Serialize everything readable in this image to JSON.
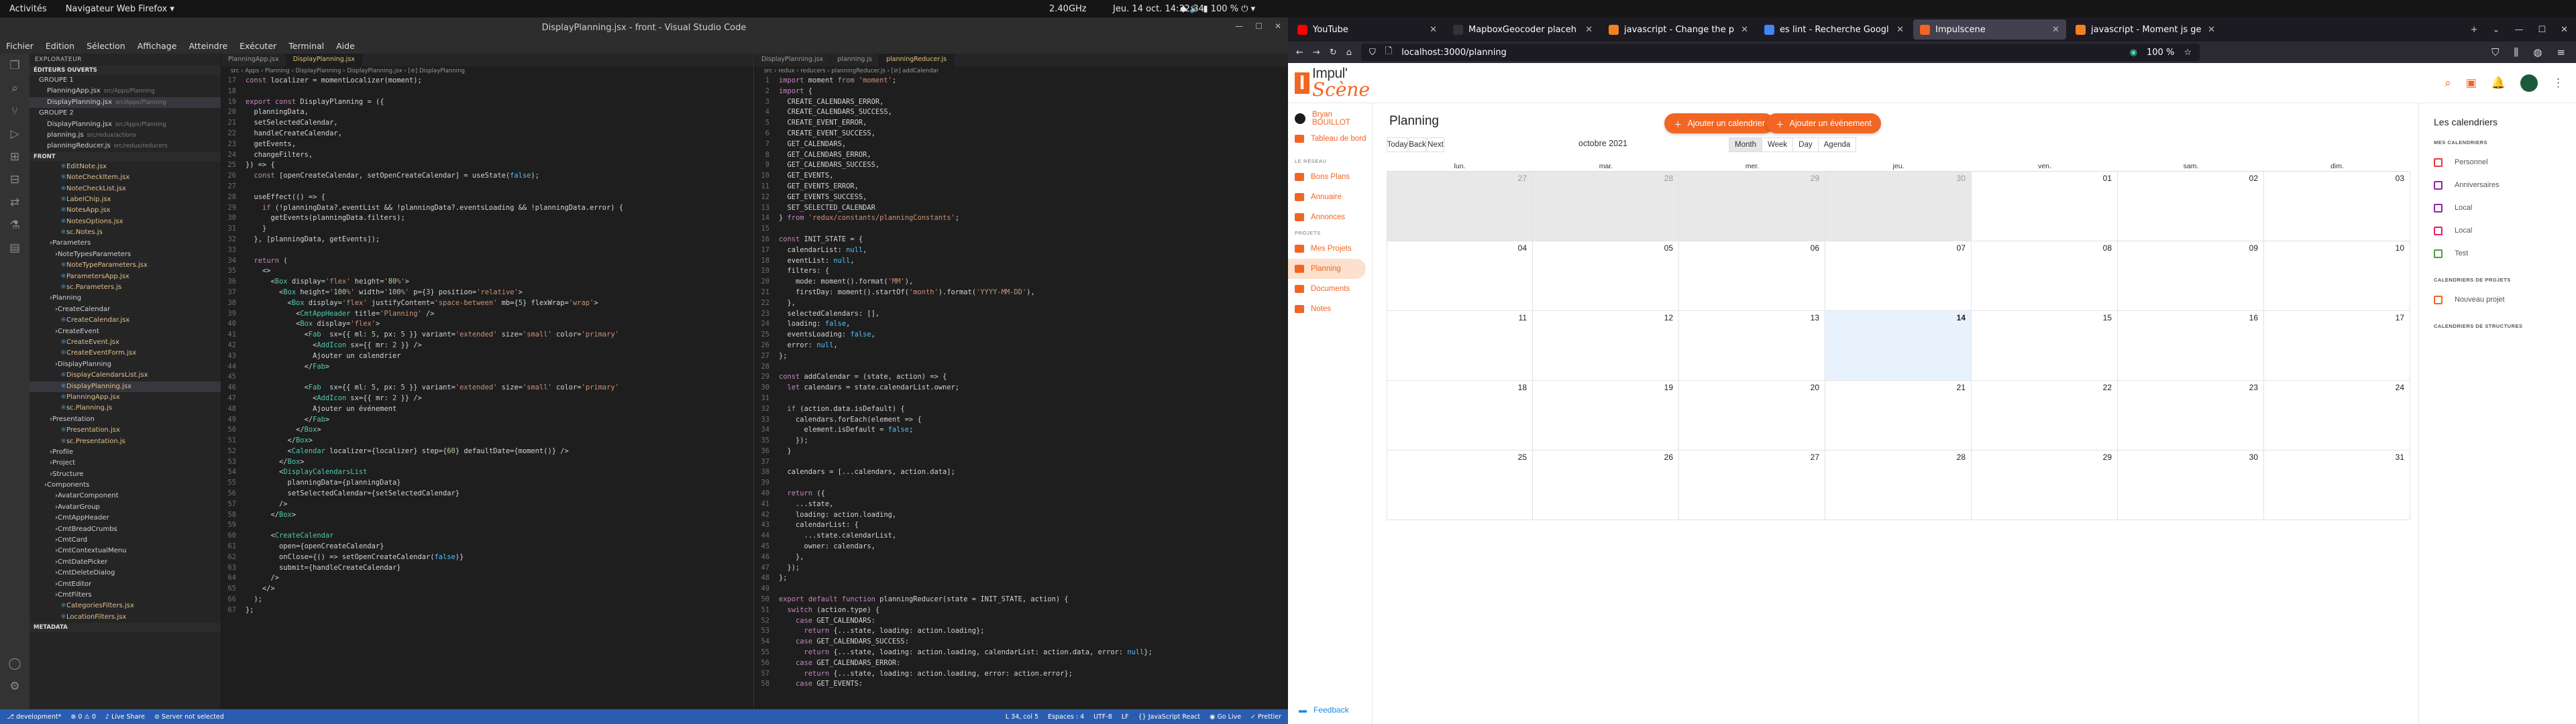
{
  "topbar": {
    "activities": "Activités",
    "app": "Navigateur Web Firefox ▾",
    "clock": "Jeu. 14 oct.  14:32:34",
    "cpu": "2.40GHz",
    "battery": "100 %"
  },
  "vscode": {
    "title": "DisplayPlanning.jsx - front - Visual Studio Code",
    "menu": [
      "Fichier",
      "Edition",
      "Sélection",
      "Affichage",
      "Atteindre",
      "Exécuter",
      "Terminal",
      "Aide"
    ],
    "explorer_header": "EXPLORATEUR",
    "open_editors": "ÉDITEURS OUVERTS",
    "group1": "GROUPE 1",
    "group2": "GROUPE 2",
    "front": "FRONT",
    "metadata": "METADATA",
    "open_files": [
      {
        "name": "PlanningApp.jsx",
        "dir": "src/Apps/Planning"
      },
      {
        "name": "DisplayPlanning.jsx",
        "dir": "src/Apps/Planning"
      },
      {
        "name": "DisplayPlanning.jsx",
        "dir": "src/Apps/Planning"
      },
      {
        "name": "planning.js",
        "dir": "src/redux/actions"
      },
      {
        "name": "planningReducer.js",
        "dir": "src/redux/reducers"
      }
    ],
    "tree": [
      "EditNote.jsx",
      "NoteCheckItem.jsx",
      "NoteCheckList.jsx",
      "LabelChip.jsx",
      "NotesApp.jsx",
      "NotesOptions.jsx",
      "sc.Notes.js",
      "Parameters",
      "NoteTypesParameters",
      "NoteTypeParameters.jsx",
      "ParametersApp.jsx",
      "sc.Parameters.js",
      "Planning",
      "CreateCalendar",
      "CreateCalendar.jsx",
      "CreateEvent",
      "CreateEvent.jsx",
      "CreateEventForm.jsx",
      "DisplayPlanning",
      "DisplayCalendarsList.jsx",
      "DisplayPlanning.jsx",
      "PlanningApp.jsx",
      "sc.Planning.js",
      "Presentation",
      "Presentation.jsx",
      "sc.Presentation.js",
      "Profile",
      "Project",
      "Structure",
      "Components",
      "AvatarComponent",
      "AvatarGroup",
      "CmtAppHeader",
      "CmtBreadCrumbs",
      "CmtCard",
      "CmtContextualMenu",
      "CmtDatePicker",
      "CmtDeleteDialog",
      "CmtEditor",
      "CmtFilters",
      "CategoriesFilters.jsx",
      "LocationFilters.jsx"
    ],
    "editor1_tabs": [
      "PlanningApp.jsx",
      "DisplayPlanning.jsx"
    ],
    "editor1_crumb": "src › Apps › Planning › DisplayPlanning › DisplayPlanning.jsx › [⊘] DisplayPlanning",
    "editor2_tabs": [
      "DisplayPlanning.jsx",
      "planning.js",
      "planningReducer.js"
    ],
    "editor2_crumb": "src › redux › reducers › planningReducer.js › [⊘] addCalendar",
    "editor1_start": 17,
    "editor1_code": [
      "const localizer = momentLocalizer(moment);",
      "",
      "export const DisplayPlanning = ({",
      "  planningData,",
      "  setSelectedCalendar,",
      "  handleCreateCalendar,",
      "  getEvents,",
      "  changeFilters,",
      "}) => {",
      "  const [openCreateCalendar, setOpenCreateCalendar] = useState(false);",
      "",
      "  useEffect(() => {",
      "    if (!planningData?.eventList && !planningData?.eventsLoading && !planningData.error) {",
      "      getEvents(planningData.filters);",
      "    }",
      "  }, [planningData, getEvents]);",
      "",
      "  return (",
      "    <>",
      "      <Box display='flex' height='80%'>",
      "        <Box height='100%' width='100%' p={3} position='relative'>",
      "          <Box display='flex' justifyContent='space-between' mb={5} flexWrap='wrap'>",
      "            <CmtAppHeader title='Planning' />",
      "            <Box display='flex'>",
      "              <Fab  sx={{ ml: 5, px: 5 }} variant='extended' size='small' color='primary'",
      "                <AddIcon sx={{ mr: 2 }} />",
      "                Ajouter un calendrier",
      "              </Fab>",
      "",
      "              <Fab  sx={{ ml: 5, px: 5 }} variant='extended' size='small' color='primary'",
      "                <AddIcon sx={{ mr: 2 }} />",
      "                Ajouter un événement",
      "              </Fab>",
      "            </Box>",
      "          </Box>",
      "          <Calendar localizer={localizer} step={60} defaultDate={moment()} />",
      "        </Box>",
      "        <DisplayCalendarsList",
      "          planningData={planningData}",
      "          setSelectedCalendar={setSelectedCalendar}",
      "        />",
      "      </Box>",
      "",
      "      <CreateCalendar",
      "        open={openCreateCalendar}",
      "        onClose={() => setOpenCreateCalendar(false)}",
      "        submit={handleCreateCalendar}",
      "      />",
      "    </>",
      "  );",
      "};"
    ],
    "editor2_start": 1,
    "editor2_code": [
      "import moment from 'moment';",
      "import {",
      "  CREATE_CALENDARS_ERROR,",
      "  CREATE_CALENDARS_SUCCESS,",
      "  CREATE_EVENT_ERROR,",
      "  CREATE_EVENT_SUCCESS,",
      "  GET_CALENDARS,",
      "  GET_CALENDARS_ERROR,",
      "  GET_CALENDARS_SUCCESS,",
      "  GET_EVENTS,",
      "  GET_EVENTS_ERROR,",
      "  GET_EVENTS_SUCCESS,",
      "  SET_SELECTED_CALENDAR",
      "} from 'redux/constants/planningConstants';",
      "",
      "const INIT_STATE = {",
      "  calendarList: null,",
      "  eventList: null,",
      "  filters: {",
      "    mode: moment().format('MM'),",
      "    firstDay: moment().startOf('month').format('YYYY-MM-DD'),",
      "  },",
      "  selectedCalendars: [],",
      "  loading: false,",
      "  eventsLoading: false,",
      "  error: null,",
      "};",
      "",
      "const addCalendar = (state, action) => {",
      "  let calendars = state.calendarList.owner;",
      "",
      "  if (action.data.isDefault) {",
      "    calendars.forEach(element => {",
      "      element.isDefault = false;",
      "    });",
      "  }",
      "",
      "  calendars = [...calendars, action.data];",
      "",
      "  return ({",
      "    ...state,",
      "    loading: action.loading,",
      "    calendarList: {",
      "      ...state.calendarList,",
      "      owner: calendars,",
      "    },",
      "  });",
      "};",
      "",
      "export default function planningReducer(state = INIT_STATE, action) {",
      "  switch (action.type) {",
      "    case GET_CALENDARS:",
      "      return {...state, loading: action.loading};",
      "    case GET_CALENDARS_SUCCESS:",
      "      return {...state, loading: action.loading, calendarList: action.data, error: null};",
      "    case GET_CALENDARS_ERROR:",
      "      return {...state, loading: action.loading, error: action.error};",
      "    case GET_EVENTS:"
    ],
    "status_left": [
      "⎇ development*",
      "⊗ 0 ⚠ 0",
      "♪ Live Share",
      "⊘ Server not selected"
    ],
    "status_right": [
      "L 34, col 5",
      "Espaces : 4",
      "UTF-8",
      "LF",
      "{} JavaScript React",
      "◉ Go Live",
      "✓ Prettier"
    ]
  },
  "firefox": {
    "tabs": [
      {
        "title": "YouTube",
        "color": "#ff0000"
      },
      {
        "title": "MapboxGeocoder placeh",
        "color": "#333333"
      },
      {
        "title": "javascript - Change the p",
        "color": "#f48024"
      },
      {
        "title": "es lint - Recherche Googl",
        "color": "#4285f4"
      },
      {
        "title": "Impulscene",
        "color": "#f26522"
      },
      {
        "title": "javascript - Moment js ge",
        "color": "#f48024"
      }
    ],
    "url": "localhost:3000/planning",
    "zoom": "100 %"
  },
  "app": {
    "brand_top": "Impul'",
    "brand_bottom": "Scène",
    "user_name": "Bryan BOUILLOT",
    "dashboard": "Tableau de bord",
    "section_network": "LE RÉSEAU",
    "network_items": [
      "Bons Plans",
      "Annuaire",
      "Annonces"
    ],
    "section_projects": "PROJETS",
    "project_items": [
      "Mes Projets",
      "Planning",
      "Documents",
      "Notes"
    ],
    "feedback": "Feedback",
    "page_title": "Planning",
    "add_calendar": "Ajouter un calendrier",
    "add_event": "Ajouter un événement",
    "today": "Today",
    "back": "Back",
    "next": "Next",
    "month_label": "octobre 2021",
    "views": [
      "Month",
      "Week",
      "Day",
      "Agenda"
    ],
    "weekdays": [
      "lun.",
      "mar.",
      "mer.",
      "jeu.",
      "ven.",
      "sam.",
      "dim."
    ],
    "days": [
      "27",
      "28",
      "29",
      "30",
      "01",
      "02",
      "03",
      "04",
      "05",
      "06",
      "07",
      "08",
      "09",
      "10",
      "11",
      "12",
      "13",
      "14",
      "15",
      "16",
      "17",
      "18",
      "19",
      "20",
      "21",
      "22",
      "23",
      "24",
      "25",
      "26",
      "27",
      "28",
      "29",
      "30",
      "31"
    ],
    "off_month_count": 4,
    "today_index": 17,
    "right_title": "Les calendriers",
    "my_calendars_label": "MES CALENDRIERS",
    "my_calendars": [
      {
        "label": "Personnel",
        "color": "#e53935"
      },
      {
        "label": "Anniversaires",
        "color": "#8e24aa"
      },
      {
        "label": "Local",
        "color": "#8e24aa"
      },
      {
        "label": "Local",
        "color": "#e91e63"
      },
      {
        "label": "Test",
        "color": "#43a047"
      }
    ],
    "project_calendars_label": "CALENDRIERS DE PROJETS",
    "project_calendars": [
      {
        "label": "Nouveau projet",
        "color": "#f26522"
      }
    ],
    "structure_calendars_label": "CALENDRIERS DE STRUCTURES"
  }
}
